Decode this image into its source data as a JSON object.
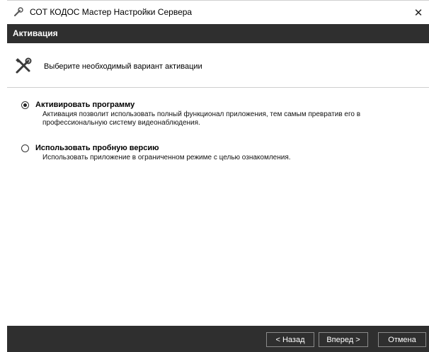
{
  "window": {
    "title": "СОТ КОДОС Мастер Настройки Сервера",
    "close_glyph": "✕"
  },
  "header": {
    "title": "Активация"
  },
  "subheader": {
    "icon": "tools-icon",
    "text": "Выберите необходимый вариант активации"
  },
  "options": [
    {
      "title": "Активировать программу",
      "description": "Активация позволит использовать полный функционал приложения, тем самым превратив его в профессиональную систему видеонаблюдения.",
      "selected": true
    },
    {
      "title": "Использовать пробную версию",
      "description": "Использовать приложение в ограниченном режиме с целью ознакомления.",
      "selected": false
    }
  ],
  "footer": {
    "back_label": "< Назад",
    "next_label": "Вперед >",
    "cancel_label": "Отмена"
  },
  "colors": {
    "dark_band": "#2f2f2f",
    "background": "#ffffff"
  }
}
